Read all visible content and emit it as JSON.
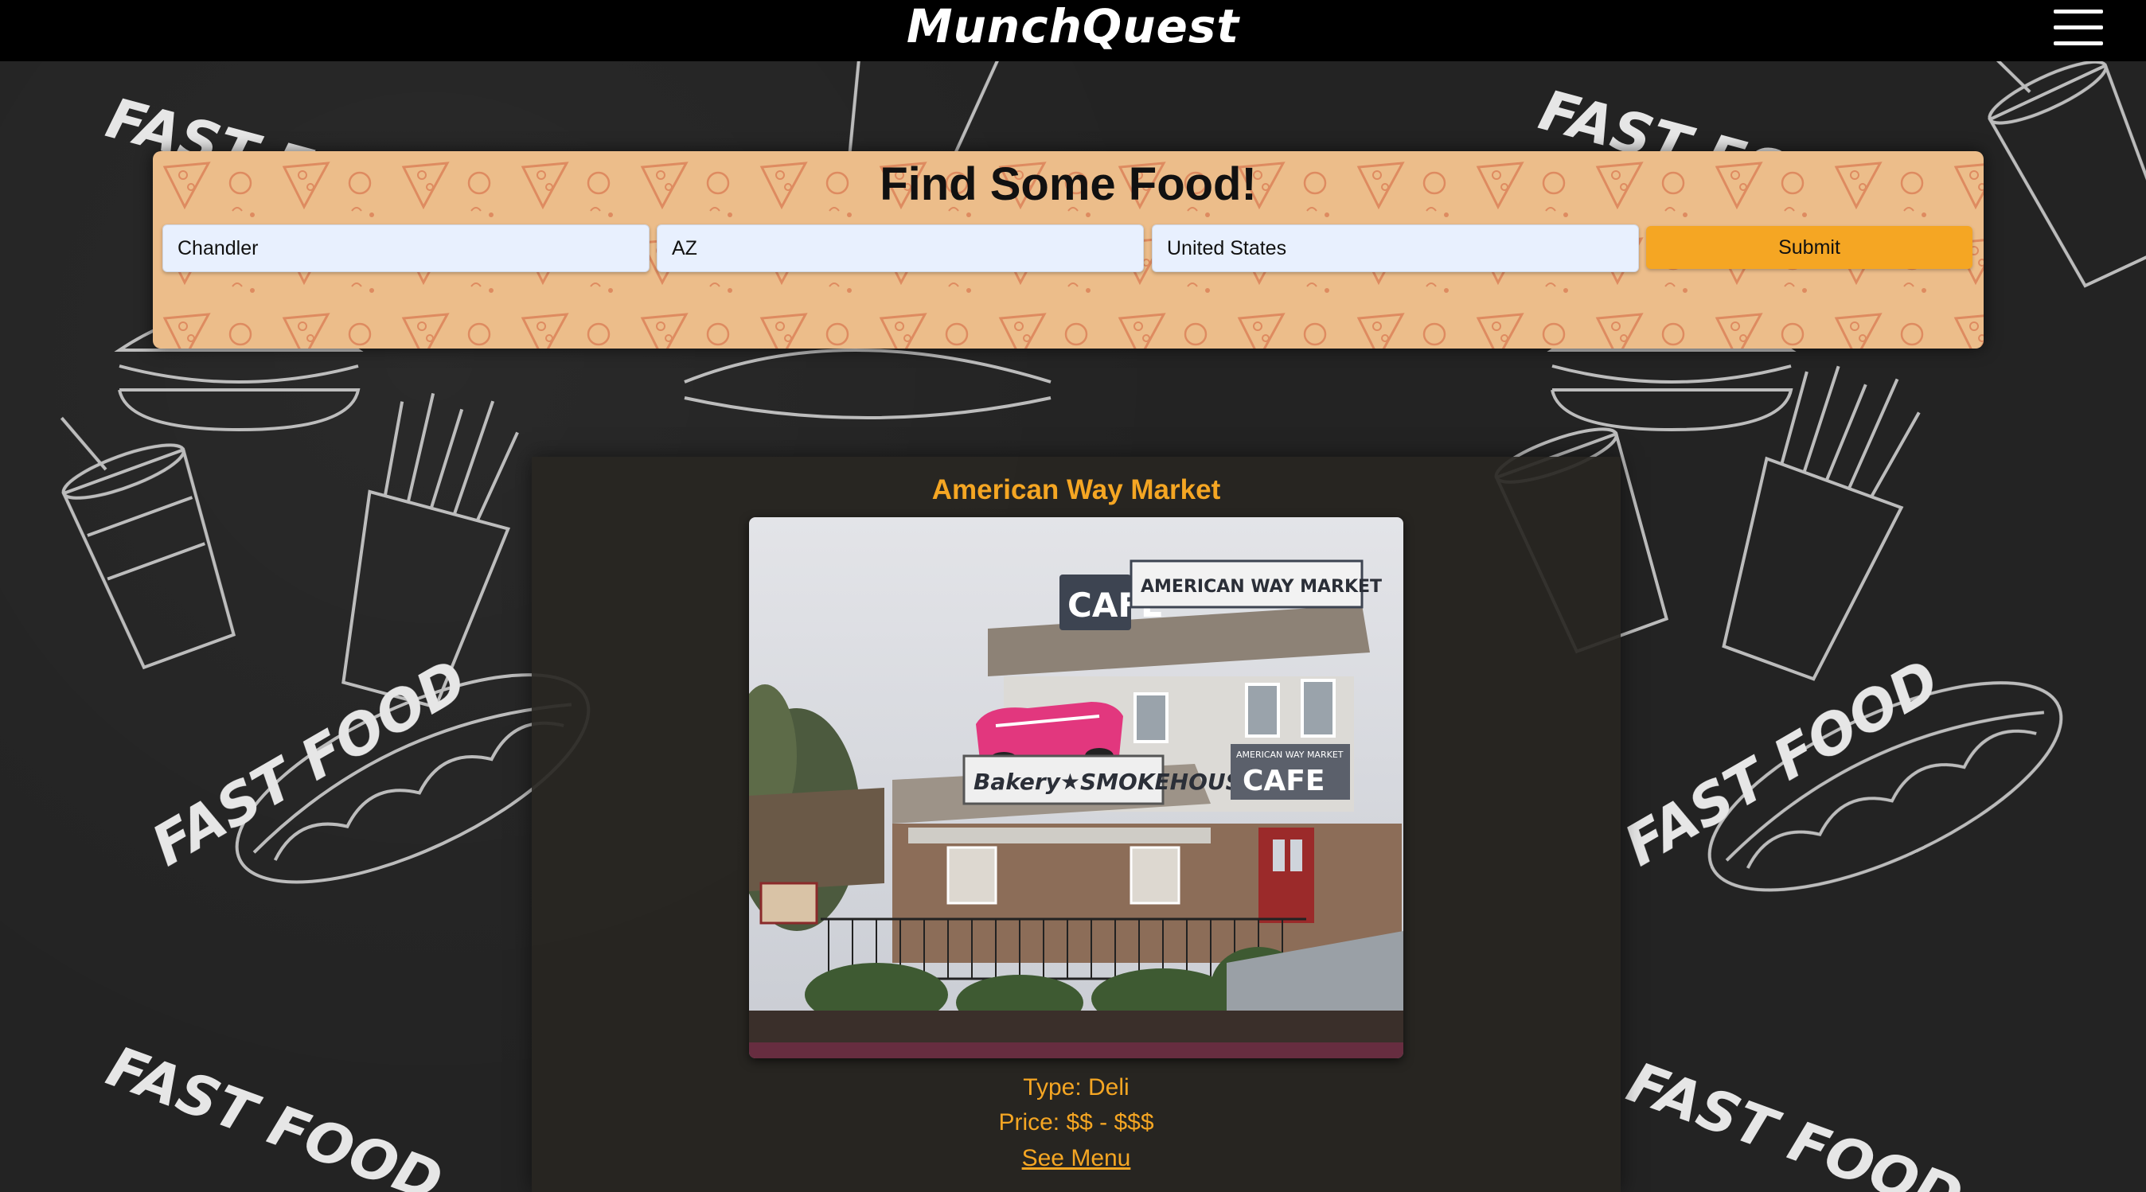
{
  "app": {
    "title": "MunchQuest"
  },
  "header": {
    "menu_icon": "hamburger-menu-icon"
  },
  "search": {
    "title": "Find Some Food!",
    "city": "Chandler",
    "state": "AZ",
    "country": "United States",
    "submit_label": "Submit"
  },
  "result": {
    "name": "American Way Market",
    "type_text": "Type: Deli",
    "price_text": "Price: $$ - $$$",
    "menu_link": "See Menu",
    "photo_signs": {
      "cafe_top": "CAFÉ",
      "market_top": "AMERICAN WAY MARKET",
      "bakery": "Bakery★SMOKEHOUSE",
      "cafe_side_small": "AMERICAN WAY MARKET",
      "cafe_side": "CAFE"
    }
  },
  "background": {
    "words": [
      "FAST FOOD",
      "FAST FOOD",
      "FAST FOOD",
      "FAST FOOD",
      "FAST FOOD",
      "FAST FOOD"
    ]
  },
  "colors": {
    "accent": "#f5a623",
    "panel": "#ecbd8a",
    "header": "#000000",
    "card": "#282622"
  }
}
